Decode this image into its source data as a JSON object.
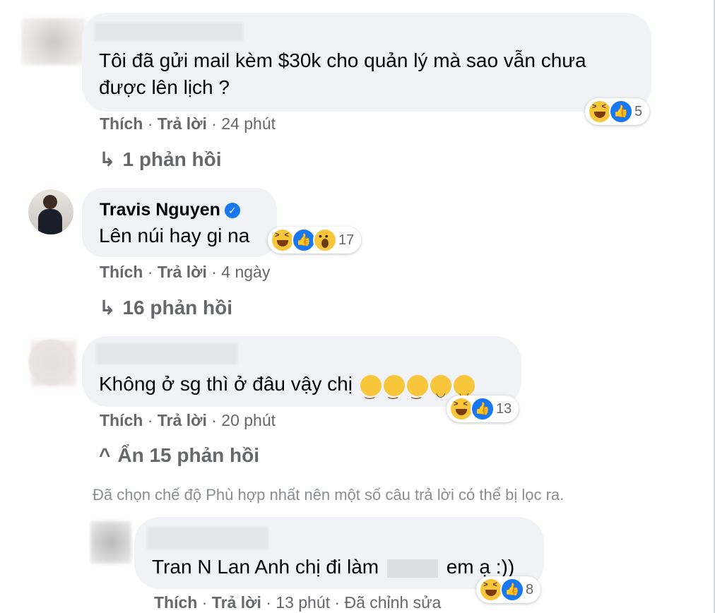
{
  "comments": [
    {
      "text": "Tôi đã gửi mail kèm $30k cho quản lý mà sao vẫn chưa",
      "text_line2": "được lên lịch ?",
      "like_label": "Thích",
      "reply_label": "Trả lời",
      "time": "· 24 phút",
      "reaction_count": "5",
      "replies_label": "1 phản hồi"
    },
    {
      "author": "Travis Nguyen",
      "text": "Lên núi hay gi na",
      "like_label": "Thích",
      "reply_label": "Trả lời",
      "time": "· 4 ngày",
      "reaction_count": "17",
      "replies_label": "16 phản hồi"
    },
    {
      "text": "Không ở sg thì ở đâu vậy chị",
      "like_label": "Thích",
      "reply_label": "Trả lời",
      "time": "· 20 phút",
      "reaction_count": "13",
      "replies_label": "Ẩn 15 phản hồi"
    }
  ],
  "filter_notice": "Đã chọn chế độ Phù hợp nhất nên một số câu trả lời có thể bị lọc ra.",
  "reply": {
    "text_before": "Tran N Lan Anh chị đi làm",
    "text_after": "em ạ :))",
    "like_label": "Thích",
    "reply_label": "Trả lời",
    "time": "· 13 phút",
    "edited": "· Đã chỉnh sửa",
    "reaction_count": "8"
  },
  "icons": {
    "reply_arrow": "↳",
    "collapse": "^",
    "verified": "✓",
    "like": "👍"
  },
  "colors": {
    "bubble": "#f0f2f5",
    "secondary_text": "#65676b",
    "like_blue": "#1877f2",
    "haha_yellow": "#f7c63b"
  }
}
